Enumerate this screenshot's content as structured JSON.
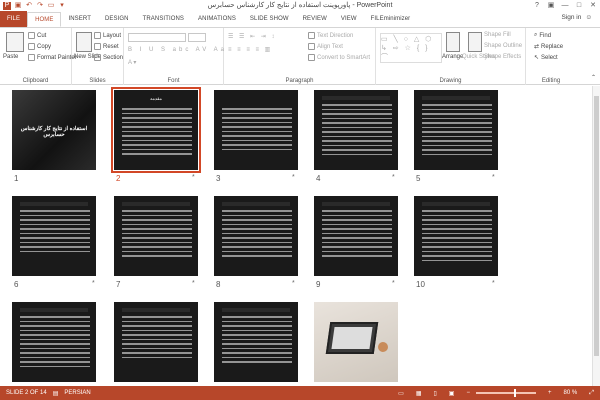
{
  "window": {
    "title": "پاورپوینت استفاده از نتایج کار کارشناس حسابرس - PowerPoint"
  },
  "tabs": [
    "FILE",
    "HOME",
    "INSERT",
    "DESIGN",
    "TRANSITIONS",
    "ANIMATIONS",
    "SLIDE SHOW",
    "REVIEW",
    "VIEW",
    "FILEminimizer"
  ],
  "active_tab": "HOME",
  "signin": "Sign in",
  "ribbon": {
    "clipboard": {
      "label": "Clipboard",
      "paste": "Paste",
      "cut": "Cut",
      "copy": "Copy",
      "format_painter": "Format Painter"
    },
    "slides": {
      "label": "Slides",
      "new_slide": "New Slide",
      "layout": "Layout",
      "reset": "Reset",
      "section": "Section"
    },
    "font": {
      "label": "Font"
    },
    "paragraph": {
      "label": "Paragraph",
      "text_direction": "Text Direction",
      "align_text": "Align Text",
      "convert": "Convert to SmartArt"
    },
    "drawing": {
      "label": "Drawing",
      "arrange": "Arrange",
      "quick_styles": "Quick Styles",
      "shape_fill": "Shape Fill",
      "shape_outline": "Shape Outline",
      "shape_effects": "Shape Effects"
    },
    "editing": {
      "label": "Editing",
      "find": "Find",
      "replace": "Replace",
      "select": "Select"
    }
  },
  "slides": [
    {
      "n": "1",
      "title": "استفاده از نتایج کار کارشناس حسابرس",
      "star": false
    },
    {
      "n": "2",
      "title": "مقدمه",
      "star": true,
      "selected": true
    },
    {
      "n": "3",
      "title": "",
      "star": true
    },
    {
      "n": "4",
      "title": "",
      "star": true
    },
    {
      "n": "5",
      "title": "",
      "star": true
    },
    {
      "n": "6",
      "title": "",
      "star": true
    },
    {
      "n": "7",
      "title": "",
      "star": true
    },
    {
      "n": "8",
      "title": "",
      "star": true
    },
    {
      "n": "9",
      "title": "",
      "star": true
    },
    {
      "n": "10",
      "title": "",
      "star": true
    },
    {
      "n": "11",
      "title": "",
      "star": true
    },
    {
      "n": "12",
      "title": "",
      "star": true
    },
    {
      "n": "13",
      "title": "",
      "star": true
    },
    {
      "n": "14",
      "title": "",
      "star": false
    }
  ],
  "status": {
    "slide": "SLIDE 2 OF 14",
    "language": "PERSIAN",
    "zoom": "80 %"
  }
}
